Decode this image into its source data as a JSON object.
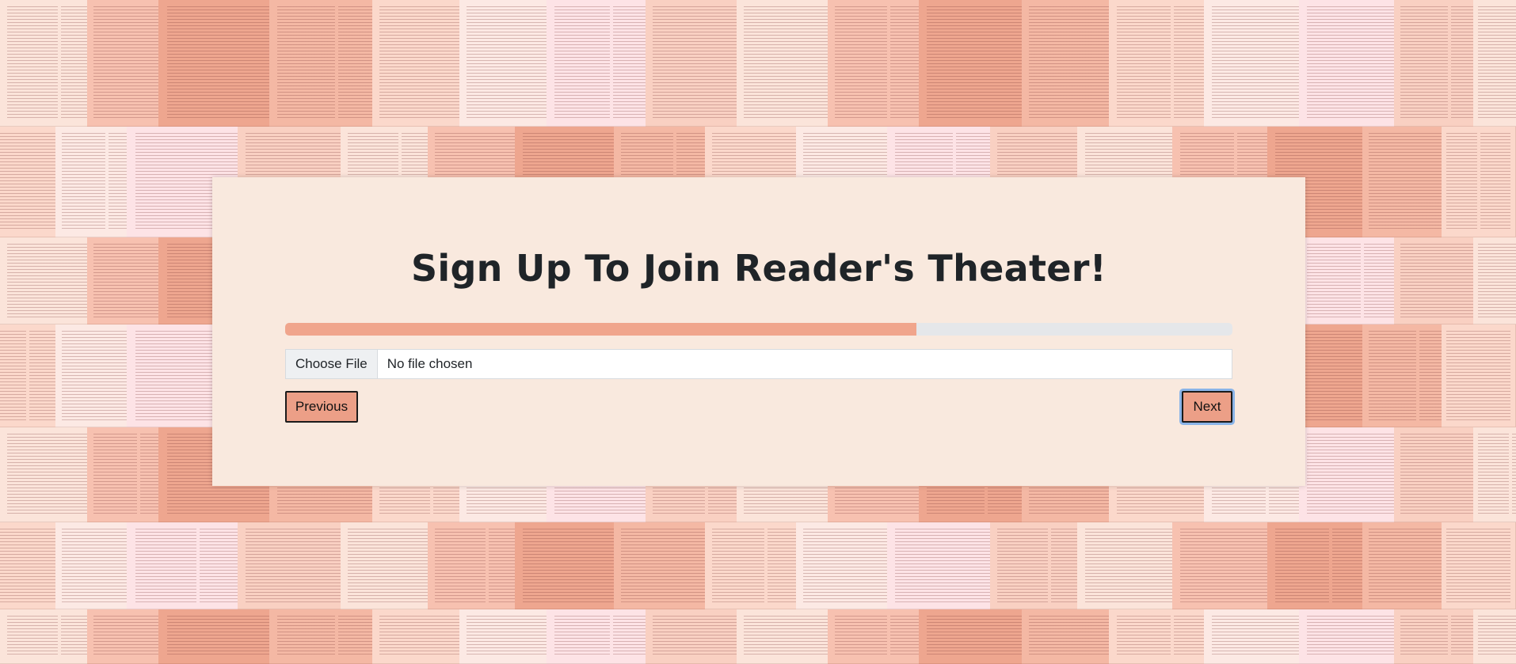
{
  "form": {
    "title": "Sign Up To Join Reader's Theater!",
    "progress_fraction": 0.666,
    "file_input": {
      "button_label": "Choose File",
      "status_text": "No file chosen"
    },
    "buttons": {
      "previous_label": "Previous",
      "next_label": "Next"
    }
  },
  "colors": {
    "card_background": "#f9e9de",
    "progress_fill": "#f0a58c",
    "progress_track": "#e5e7ea",
    "button_fill": "#ec9f87",
    "focus_ring": "#8ab4e8"
  }
}
